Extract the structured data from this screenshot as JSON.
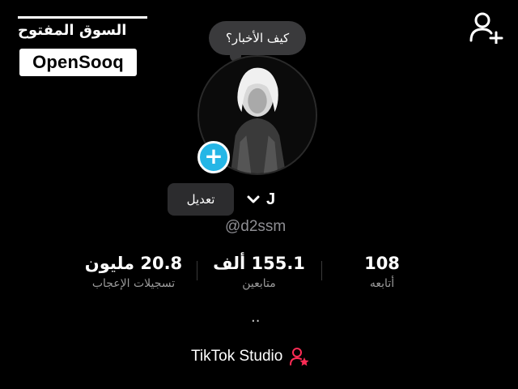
{
  "watermark": {
    "arabic_text": "السوق المفتوح",
    "brand": "OpenSooq"
  },
  "icons": {
    "add_friend": "add-friend-icon",
    "plus": "plus-icon",
    "chevron": "chevron-down-icon",
    "studio": "creator-star-icon"
  },
  "profile": {
    "bubble_text": "كيف الأخبار؟",
    "plus_symbol": "+",
    "edit_label": "تعديل",
    "name": "J",
    "handle": "@d2ssm"
  },
  "stats": [
    {
      "value": "108",
      "label": "أتابعه"
    },
    {
      "value": "155.1 ألف",
      "label": "متابعين"
    },
    {
      "value": "20.8 مليون",
      "label": "تسجيلات الإعجاب"
    }
  ],
  "bio_placeholder": "..",
  "studio": {
    "label": "TikTok Studio"
  },
  "colors": {
    "background": "#000000",
    "accent_blue": "#25b6e6",
    "accent_pink": "#fe2c55",
    "muted_text": "#8e8e93"
  }
}
